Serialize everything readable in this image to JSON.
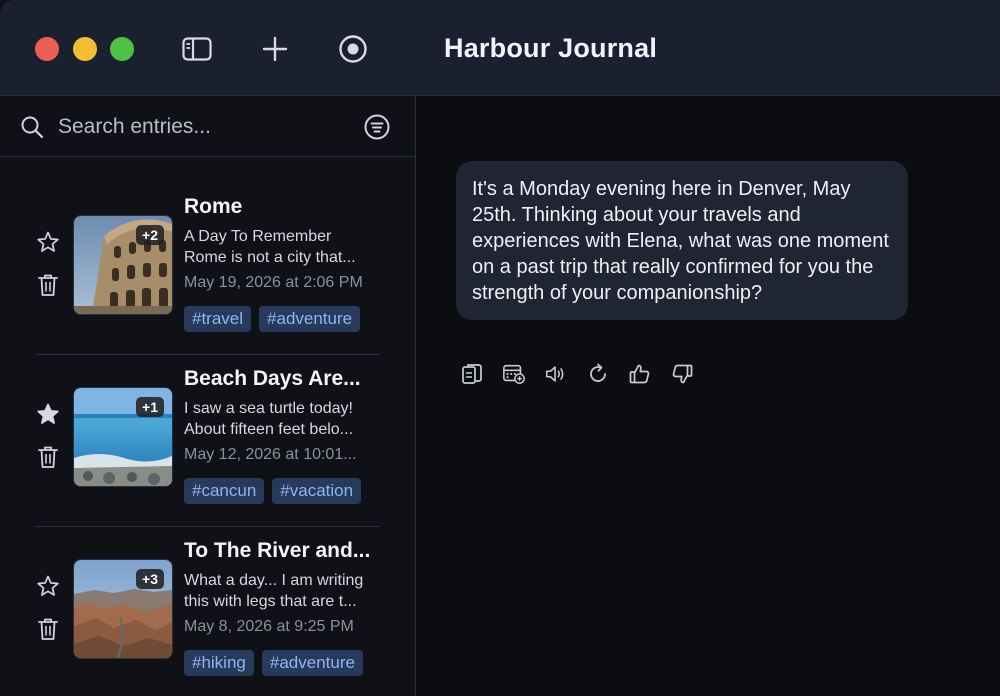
{
  "app": {
    "title": "Harbour Journal"
  },
  "search": {
    "placeholder": "Search entries..."
  },
  "entries": [
    {
      "title": "Rome",
      "snippet_line1": "A Day To Remember",
      "snippet_line2": "Rome is not a city that...",
      "date": "May 19, 2026 at 2:06 PM",
      "badge": "+2",
      "starred": false,
      "tags": [
        "#travel",
        "#adventure"
      ]
    },
    {
      "title": "Beach Days Are...",
      "snippet_line1": "I saw a sea turtle today!",
      "snippet_line2": "About fifteen feet belo...",
      "date": "May 12, 2026 at 10:01...",
      "badge": "+1",
      "starred": true,
      "tags": [
        "#cancun",
        "#vacation"
      ]
    },
    {
      "title": "To The River and...",
      "snippet_line1": "What a day... I am writing",
      "snippet_line2": "this with legs that are t...",
      "date": "May 8, 2026 at 9:25 PM",
      "badge": "+3",
      "starred": false,
      "tags": [
        "#hiking",
        "#adventure"
      ]
    }
  ],
  "message": {
    "text": "It's a Monday evening here in Denver, May 25th. Thinking about your travels and experiences with Elena, what was one moment on a past trip that really confirmed for you the strength of your companionship?"
  },
  "actions": [
    "copy-icon",
    "calendar-add-icon",
    "speaker-icon",
    "regenerate-icon",
    "thumbs-up-icon",
    "thumbs-down-icon"
  ],
  "colors": {
    "accent_tag_bg": "#283a5c",
    "accent_tag_text": "#8fb4ee",
    "bubble": "#1f2533"
  }
}
